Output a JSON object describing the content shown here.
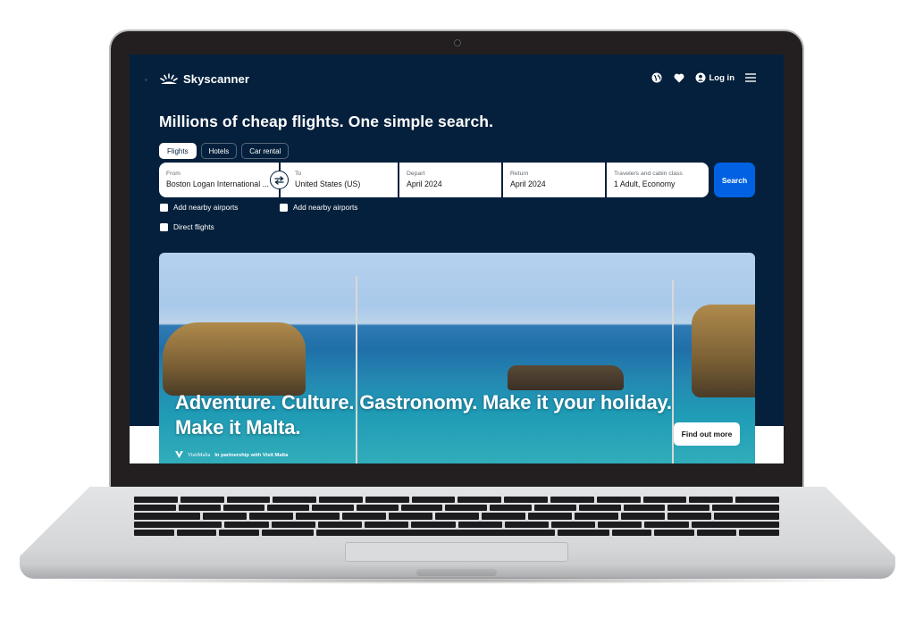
{
  "brand": {
    "name": "Skyscanner",
    "accent": "#0062e3",
    "navy": "#05203c"
  },
  "header": {
    "icons": [
      "globe-icon",
      "heart-icon",
      "user-icon",
      "menu-icon"
    ],
    "login_label": "Log in"
  },
  "hero": {
    "headline": "Millions of cheap flights. One simple search."
  },
  "tabs": [
    {
      "label": "Flights",
      "active": true
    },
    {
      "label": "Hotels",
      "active": false
    },
    {
      "label": "Car rental",
      "active": false
    }
  ],
  "search": {
    "from": {
      "label": "From",
      "value": "Boston Logan International ..."
    },
    "to": {
      "label": "To",
      "value": "United States (US)"
    },
    "depart": {
      "label": "Depart",
      "value": "April 2024"
    },
    "return": {
      "label": "Return",
      "value": "April 2024"
    },
    "travelers": {
      "label": "Travelers and cabin class",
      "value": "1 Adult, Economy"
    },
    "button_label": "Search"
  },
  "options": {
    "nearby_from": {
      "label": "Add nearby airports",
      "checked": false
    },
    "nearby_to": {
      "label": "Add nearby airports",
      "checked": false
    },
    "direct": {
      "label": "Direct flights",
      "checked": false
    }
  },
  "banner": {
    "title": "Adventure. Culture. Gastronomy. Make it your holiday. Make it Malta.",
    "partner_logo": "VisitMalta",
    "partner_text": "In partnership with Visit Malta",
    "cta_label": "Find out more"
  }
}
